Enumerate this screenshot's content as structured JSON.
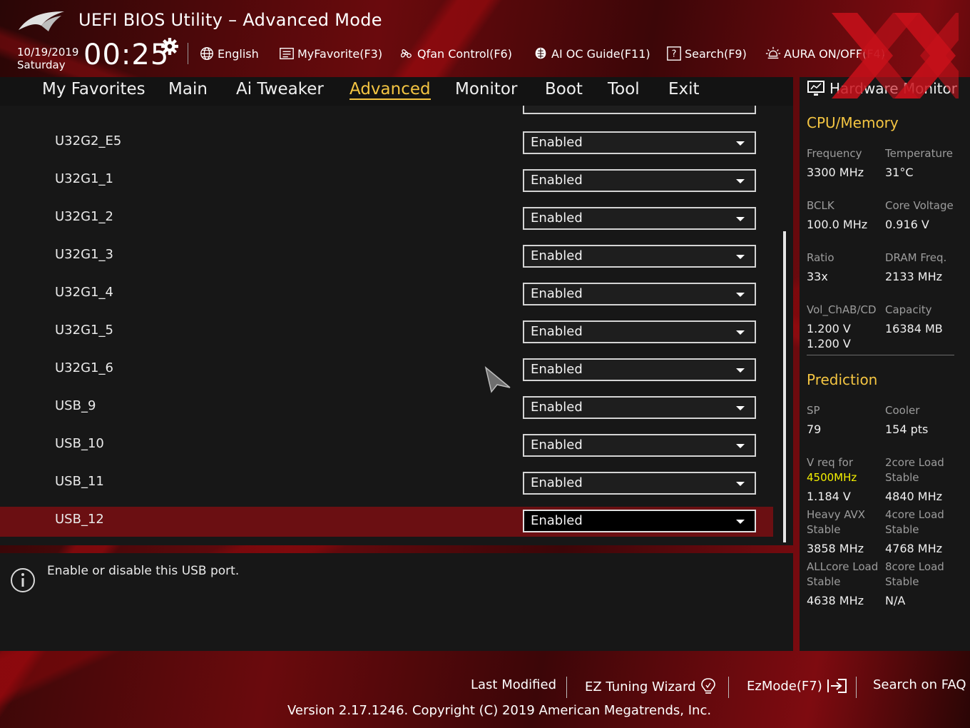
{
  "header": {
    "title": "UEFI BIOS Utility – Advanced Mode",
    "date": "10/19/2019",
    "day": "Saturday",
    "time": "00:25",
    "toolbar": [
      {
        "icon": "globe-icon",
        "label": "English"
      },
      {
        "icon": "favorites-list-icon",
        "label": "MyFavorite(F3)"
      },
      {
        "icon": "fan-icon",
        "label": "Qfan Control(F6)"
      },
      {
        "icon": "ai-brain-icon",
        "label": "AI OC Guide(F11)"
      },
      {
        "icon": "question-icon",
        "label": "Search(F9)"
      },
      {
        "icon": "aura-light-icon",
        "label": "AURA ON/OFF(F4)"
      }
    ]
  },
  "menu": {
    "tabs": [
      "My Favorites",
      "Main",
      "Ai Tweaker",
      "Advanced",
      "Monitor",
      "Boot",
      "Tool",
      "Exit"
    ],
    "active": "Advanced"
  },
  "settings": {
    "rows": [
      {
        "label": "U32G2_E5",
        "value": "Enabled"
      },
      {
        "label": "U32G1_1",
        "value": "Enabled"
      },
      {
        "label": "U32G1_2",
        "value": "Enabled"
      },
      {
        "label": "U32G1_3",
        "value": "Enabled"
      },
      {
        "label": "U32G1_4",
        "value": "Enabled"
      },
      {
        "label": "U32G1_5",
        "value": "Enabled"
      },
      {
        "label": "U32G1_6",
        "value": "Enabled"
      },
      {
        "label": "USB_9",
        "value": "Enabled"
      },
      {
        "label": "USB_10",
        "value": "Enabled"
      },
      {
        "label": "USB_11",
        "value": "Enabled"
      },
      {
        "label": "USB_12",
        "value": "Enabled"
      }
    ],
    "selected": "USB_12"
  },
  "help": {
    "text": "Enable or disable this USB port."
  },
  "hardware_monitor": {
    "title": "Hardware Monitor",
    "cpu_memory": {
      "heading": "CPU/Memory",
      "frequency_label": "Frequency",
      "frequency": "3300 MHz",
      "temperature_label": "Temperature",
      "temperature": "31°C",
      "bclk_label": "BCLK",
      "bclk": "100.0 MHz",
      "core_voltage_label": "Core Voltage",
      "core_voltage": "0.916 V",
      "ratio_label": "Ratio",
      "ratio": "33x",
      "dram_freq_label": "DRAM Freq.",
      "dram_freq": "2133 MHz",
      "vol_label": "Vol_ChAB/CD",
      "vol_ab": "1.200 V",
      "vol_cd": "1.200 V",
      "capacity_label": "Capacity",
      "capacity": "16384 MB"
    },
    "prediction": {
      "heading": "Prediction",
      "sp_label": "SP",
      "sp": "79",
      "cooler_label": "Cooler",
      "cooler": "154 pts",
      "vreq_label": "V req for",
      "vreq_freq": "4500MHz",
      "vreq": "1.184 V",
      "core2_label_1": "2core Load",
      "core2_label_2": "Stable",
      "core2": "4840 MHz",
      "avx_label_1": "Heavy AVX",
      "avx_label_2": "Stable",
      "avx": "3858 MHz",
      "core4_label_1": "4core Load",
      "core4_label_2": "Stable",
      "core4": "4768 MHz",
      "allcore_label_1": "ALLcore Load",
      "allcore_label_2": "Stable",
      "allcore": "4638 MHz",
      "core8_label_1": "8core Load",
      "core8_label_2": "Stable",
      "core8": "N/A"
    }
  },
  "footer": {
    "last_modified": "Last Modified",
    "ez_tuning": "EZ Tuning Wizard",
    "ezmode": "EzMode(F7)",
    "search_faq": "Search on FAQ",
    "version": "Version 2.17.1246. Copyright (C) 2019 American Megatrends, Inc."
  },
  "colors": {
    "accent": "#f4c542",
    "selected_row": "#6b0f12",
    "prediction_highlight": "#f4f000"
  }
}
